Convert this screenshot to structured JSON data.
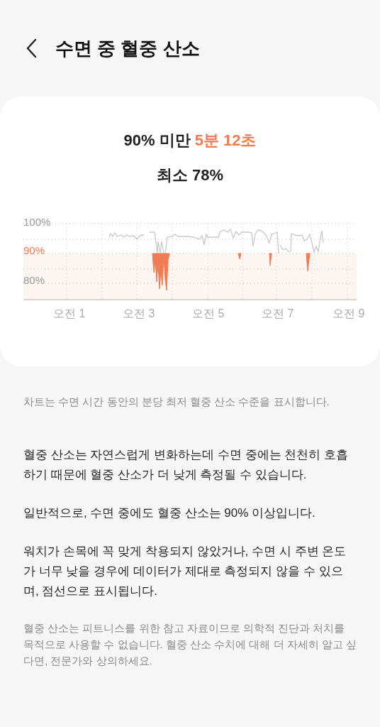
{
  "header": {
    "title": "수면 중 혈중 산소"
  },
  "summary": {
    "label": "90% 미만",
    "value": "5분 12초",
    "minimum": "최소 78%"
  },
  "chart": {
    "y_labels": [
      {
        "text": "100%",
        "highlight": false
      },
      {
        "text": "90%",
        "highlight": true
      },
      {
        "text": "80%",
        "highlight": false
      }
    ],
    "x_labels": [
      "오전 1",
      "오전 3",
      "오전 5",
      "오전 7",
      "오전 9"
    ]
  },
  "notes": [
    {
      "kind": "caption",
      "text": "차트는 수면 시간 동안의 분당 최저 혈중 산소 수준을 표시합니다."
    },
    {
      "kind": "body",
      "text": "혈중 산소는 자연스럽게 변화하는데 수면 중에는 천천히 호흡하기 때문에 혈중 산소가 더 낮게 측정될 수 있습니다."
    },
    {
      "kind": "body",
      "text": "일반적으로, 수면 중에도 혈중 산소는 90% 이상입니다."
    },
    {
      "kind": "body",
      "text": "워치가 손목에 꼭 맞게 착용되지 않았거나, 수면 시 주변 온도가 너무 낮을 경우에 데이터가 제대로 측정되지 않을 수 있으며, 점선으로 표시됩니다."
    },
    {
      "kind": "caption",
      "text": "혈중 산소는 피트니스를 위한 참고 자료이므로 의학적 진단과 처치를 목적으로 사용할 수 없습니다. 혈중 산소 수치에 대해 더 자세히 알고 싶다면, 전문가와 상의하세요."
    }
  ]
}
